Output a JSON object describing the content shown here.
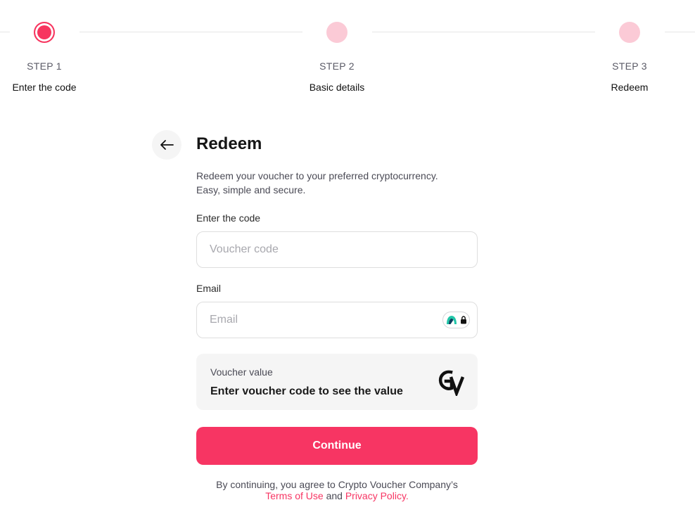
{
  "stepper": {
    "steps": [
      {
        "label": "STEP 1",
        "name": "Enter the code",
        "state": "active"
      },
      {
        "label": "STEP 2",
        "name": "Basic details",
        "state": "pending"
      },
      {
        "label": "STEP 3",
        "name": "Redeem",
        "state": "pending"
      }
    ]
  },
  "form": {
    "title": "Redeem",
    "subtitle_line1": "Redeem your voucher to your preferred cryptocurrency.",
    "subtitle_line2": "Easy, simple and secure.",
    "code_label": "Enter the code",
    "code_placeholder": "Voucher code",
    "email_label": "Email",
    "email_placeholder": "Email"
  },
  "voucher_value": {
    "label": "Voucher value",
    "text": "Enter voucher code to see the value",
    "logo_icon": "gv-logo-icon"
  },
  "actions": {
    "continue_label": "Continue"
  },
  "terms": {
    "prefix": "By continuing, you agree to Crypto Voucher Company’s",
    "terms_link": "Terms of Use",
    "conjunction": "and",
    "privacy_link": "Privacy Policy",
    "suffix": "."
  },
  "colors": {
    "accent": "#f73563",
    "step_pending": "#fbcad6",
    "panel_bg": "#f5f5f5"
  },
  "icons": {
    "back": "arrow-left-icon",
    "password_manager": "password-manager-icon"
  }
}
